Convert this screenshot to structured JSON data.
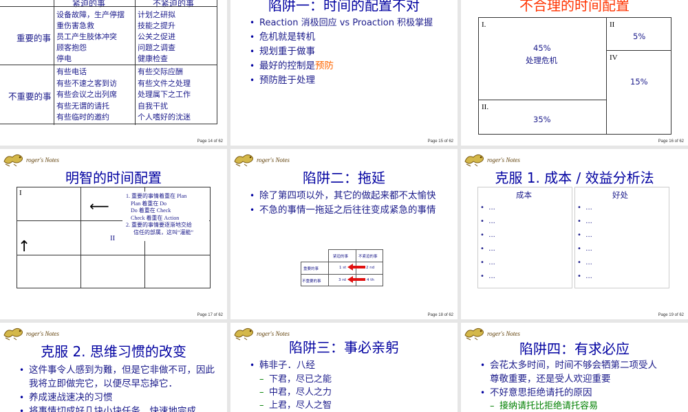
{
  "logo_text": "roger's Notes",
  "s14": {
    "hdr_urgent": "紧迫的事",
    "hdr_not_urgent": "不紧迫的事",
    "row1_label": "重要的事",
    "row2_label": "不重要的事",
    "q1": [
      "设备故障，生产停摆",
      "重伤害急救",
      "员工产生肢体冲突",
      "顾客抱怨",
      "停电"
    ],
    "q2": [
      "计划之研拟",
      "技能之提升",
      "公关之促进",
      "问题之调查",
      "健康检查"
    ],
    "q3": [
      "有些电话",
      "有些不速之客到访",
      "有些会议之出列席",
      "有些无谓的请托",
      "有些临时的邀约"
    ],
    "q4": [
      "有些交际应酬",
      "有些文件之处理",
      "处理属下之工作",
      "自我干扰",
      "个人嗜好的沈迷"
    ],
    "page": "Page 14 of 62"
  },
  "s15": {
    "title": "陷阱一：时间的配置不对",
    "items": [
      "Reaction 消极回应 vs Proaction 积极掌握",
      "危机就是转机",
      "规划重于做事"
    ],
    "item4_pre": "最好的控制是",
    "item4_hl": "预防",
    "item5": "预防胜于处理",
    "page": "Page 15 of 62"
  },
  "s16": {
    "title": "不合理的时间配置",
    "q1_label": "I.",
    "q1_pct": "45%",
    "q1_text": "处理危机",
    "q2_label": "II",
    "q2_pct": "5%",
    "q3_label": "II.",
    "q3_pct": "35%",
    "q4_label": "IV",
    "q4_pct": "15%",
    "page": "Page 16 of 62"
  },
  "s17": {
    "title": "明智的时间配置",
    "q1_label": "I",
    "q2_label": "II",
    "notes": [
      "1. 重要的事情着重在 Plan",
      "Plan 着重在 Do",
      "Do 着重在 Check",
      "Check 着重在 Action",
      "2. 重要的事情要逐渐地交给",
      "信任的部属，这叫“灌能”"
    ],
    "page": "Page 17 of 62"
  },
  "s18": {
    "title": "陷阱二：拖延",
    "items": [
      "除了第四项以外，其它的做起来都不太愉快",
      "不急的事情一拖延之后往往变成紧急的事情"
    ],
    "mini_hdr1": "紧迫的事",
    "mini_hdr2": "不紧迫的事",
    "mini_row1": "重要的事",
    "mini_row2": "不重要的事",
    "mini_1st": "1 st",
    "mini_2nd": "2 nd",
    "mini_3rd": "3 rd",
    "mini_4th": "4 th",
    "page": "Page 18 of 62"
  },
  "s19": {
    "title": "克服 1. 成本 / 效益分析法",
    "col1": "成本",
    "col2": "好处",
    "dots": [
      "...",
      "...",
      "...",
      "...",
      "...",
      "..."
    ],
    "page": "Page 19 of 62"
  },
  "s20": {
    "title": "克服 2. 思维习惯的改变",
    "items": [
      "这件事令人感到为難，但是它非做不可，因此我将立即做完它，以便尽早忘掉它．",
      "养成速战速决的习惯",
      "将事情切成好几块小块任务，快速地完成"
    ]
  },
  "s21": {
    "title": "陷阱三：事必亲躬",
    "item1": "韩非子．八经",
    "subs": [
      "下君，尽已之能",
      "中君，尽人之力",
      "上君，尽人之智"
    ]
  },
  "s22": {
    "title": "陷阱四：有求必应",
    "items": [
      "会花太多时间，时间不够会牺第二项受人尊敬重要，还是受人欢迎重要",
      "不好意思拒绝请托的原因"
    ],
    "sub1": "接纳请托比拒绝请托容易"
  }
}
